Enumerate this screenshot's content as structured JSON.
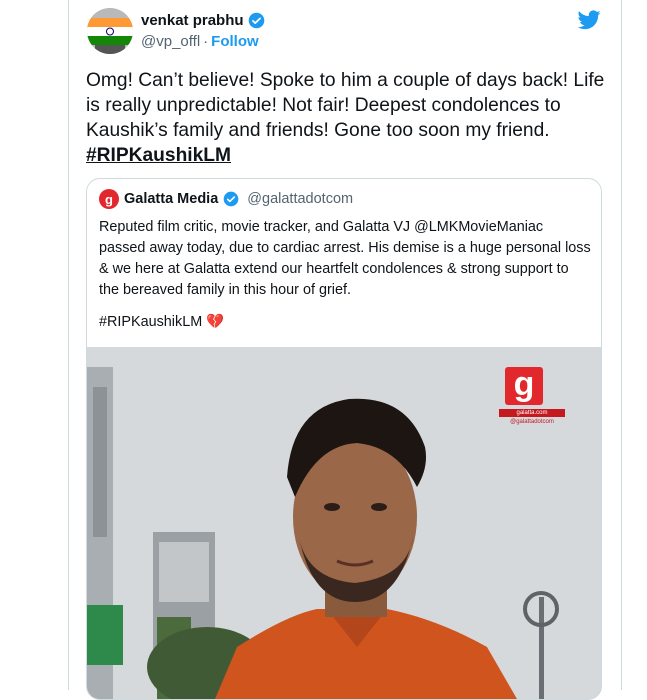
{
  "tweet": {
    "author_name": "venkat prabhu",
    "handle": "@vp_offl",
    "separator": "·",
    "follow_label": "Follow",
    "text": "Omg! Can’t believe! Spoke to him a couple of days back! Life is really unpredictable! Not fair! Deepest condolences to Kaushik’s family and friends! Gone too soon my friend.",
    "hashtag": "#RIPKaushikLM"
  },
  "quote": {
    "author_name": "Galatta Media",
    "avatar_letter": "g",
    "handle": "@galattadotcom",
    "text": "Reputed film critic, movie tracker, and Galatta VJ @LMKMovieManiac passed away today, due to cardiac arrest. His demise is a huge personal loss & we here at Galatta extend our heartfelt condolences & strong support to the bereaved family in this hour of grief.",
    "hashtag": "#RIPKaushikLM",
    "hashtag_emoji": "💔",
    "photo": {
      "logo_letter": "g",
      "logo_tagline": "galatta.com",
      "logo_handle": "@galattadotcom"
    }
  },
  "colors": {
    "accent": "#1d9bf0",
    "galatta_red": "#e2282d",
    "text": "#0f1419",
    "muted": "#536471"
  }
}
